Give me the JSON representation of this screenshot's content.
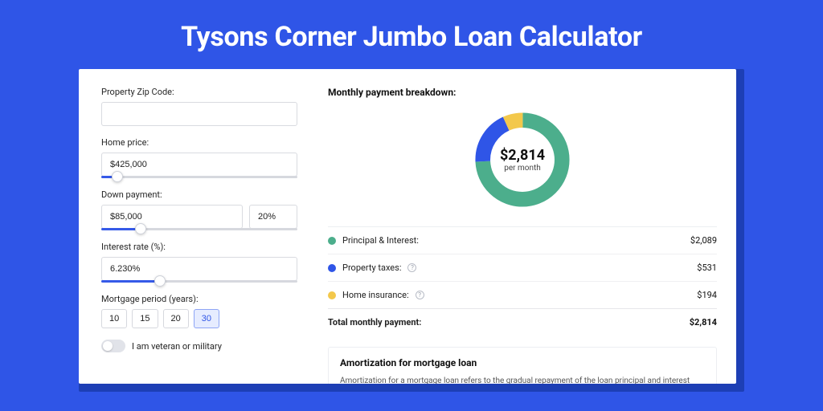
{
  "title": "Tysons Corner Jumbo Loan Calculator",
  "form": {
    "zip": {
      "label": "Property Zip Code:",
      "value": ""
    },
    "home_price": {
      "label": "Home price:",
      "value": "$425,000",
      "slider_pct": 8
    },
    "down_payment": {
      "label": "Down payment:",
      "amount": "$85,000",
      "percent": "20%",
      "slider_pct": 20
    },
    "interest": {
      "label": "Interest rate (%):",
      "value": "6.230%",
      "slider_pct": 30
    },
    "period": {
      "label": "Mortgage period (years):",
      "options": [
        "10",
        "15",
        "20",
        "30"
      ],
      "selected": "30"
    },
    "veteran": {
      "label": "I am veteran or military",
      "checked": false
    }
  },
  "breakdown": {
    "heading": "Monthly payment breakdown:",
    "center_amount": "$2,814",
    "center_sub": "per month",
    "items": [
      {
        "label": "Principal & Interest:",
        "value": "$2,089",
        "color": "#4cae8c",
        "info": false,
        "num": 2089
      },
      {
        "label": "Property taxes:",
        "value": "$531",
        "color": "#2f55e7",
        "info": true,
        "num": 531
      },
      {
        "label": "Home insurance:",
        "value": "$194",
        "color": "#f3c84b",
        "info": true,
        "num": 194
      }
    ],
    "total": {
      "label": "Total monthly payment:",
      "value": "$2,814",
      "num": 2814
    }
  },
  "amortization": {
    "heading": "Amortization for mortgage loan",
    "text": "Amortization for a mortgage loan refers to the gradual repayment of the loan principal and interest over a specified"
  },
  "chart_data": {
    "type": "pie",
    "title": "Monthly payment breakdown",
    "series": [
      {
        "name": "Principal & Interest",
        "value": 2089,
        "color": "#4cae8c"
      },
      {
        "name": "Property taxes",
        "value": 531,
        "color": "#2f55e7"
      },
      {
        "name": "Home insurance",
        "value": 194,
        "color": "#f3c84b"
      }
    ],
    "total": 2814,
    "center_label": "$2,814 per month"
  }
}
